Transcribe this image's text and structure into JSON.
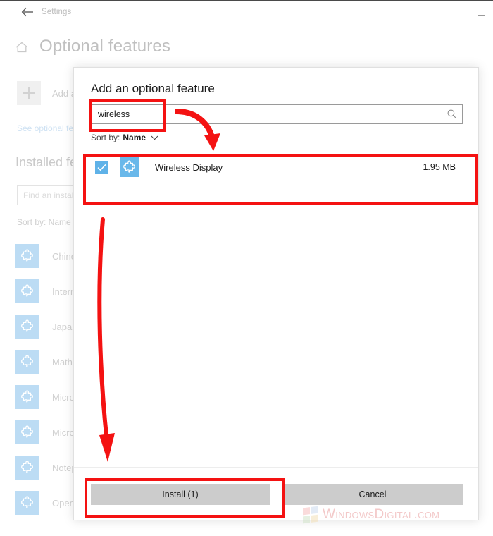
{
  "window": {
    "titlebar_title": "Settings",
    "back_icon": "back-arrow-icon",
    "minimize_icon": "minimize-icon"
  },
  "page": {
    "home_icon": "home-icon",
    "title": "Optional features",
    "add_feature": {
      "icon": "plus-icon",
      "label": "Add a fe"
    },
    "see_optional_link": "See optional fea",
    "installed_heading": "Installed fea",
    "find_installed_placeholder": "Find an install",
    "sort_row": "Sort by: Name",
    "installed_items": [
      {
        "icon": "puzzle-piece-icon",
        "name": "Chinese"
      },
      {
        "icon": "puzzle-piece-icon",
        "name": "Internet"
      },
      {
        "icon": "puzzle-piece-icon",
        "name": "Japanese"
      },
      {
        "icon": "puzzle-piece-icon",
        "name": "Math Re"
      },
      {
        "icon": "puzzle-piece-icon",
        "name": "Microso"
      },
      {
        "icon": "puzzle-piece-icon",
        "name": "Microso"
      },
      {
        "icon": "puzzle-piece-icon",
        "name": "Notepad"
      },
      {
        "icon": "puzzle-piece-icon",
        "name": "OpenSS"
      }
    ]
  },
  "dialog": {
    "title": "Add an optional feature",
    "search": {
      "value": "wireless",
      "placeholder": "",
      "icon": "search-icon"
    },
    "sort": {
      "label": "Sort by:",
      "value": "Name",
      "chevron": "chevron-down-icon"
    },
    "results": [
      {
        "checked": true,
        "icon": "puzzle-piece-icon",
        "name": "Wireless Display",
        "size": "1.95 MB"
      }
    ],
    "buttons": {
      "install": "Install (1)",
      "cancel": "Cancel"
    }
  },
  "annotations": {
    "accent_color": "#f41212",
    "highlight_search": "redbox-search-field",
    "highlight_result": "redbox-result-row",
    "highlight_install": "redbox-install-button",
    "arrow_curved": "red-curved-arrow",
    "arrow_long": "red-long-arrow"
  },
  "watermark": {
    "text": "WindowsDigital.com"
  },
  "colors": {
    "accent_blue": "#69b8ea",
    "checkbox_blue": "#5fb2e8",
    "button_gray": "#cccccc",
    "annotation_red": "#f41212"
  }
}
